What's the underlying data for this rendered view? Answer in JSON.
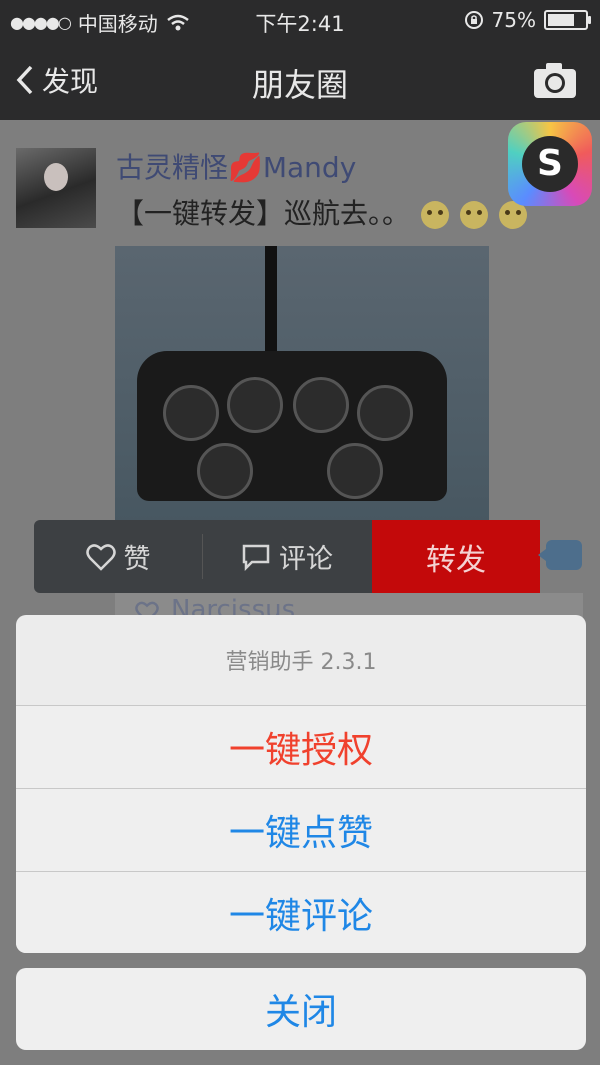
{
  "status_bar": {
    "carrier": "中国移动",
    "time": "下午2:41",
    "battery_percent": "75%",
    "battery_level": 0.75
  },
  "nav": {
    "back_label": "发现",
    "title": "朋友圈",
    "right_icon": "camera-icon"
  },
  "post": {
    "author": "古灵精怪💋Mandy",
    "text": "【一键转发】巡航去。。"
  },
  "actions": {
    "like": "赞",
    "comment": "评论",
    "forward": "转发"
  },
  "comment_preview": {
    "name": "Narcissus"
  },
  "sheet": {
    "title": "营销助手 2.3.1",
    "items": [
      "一键授权",
      "一键点赞",
      "一键评论"
    ],
    "cancel": "关闭"
  },
  "colors": {
    "destructive": "#f0412d",
    "action_blue": "#1f87e6",
    "forward_red": "#c3090a"
  }
}
